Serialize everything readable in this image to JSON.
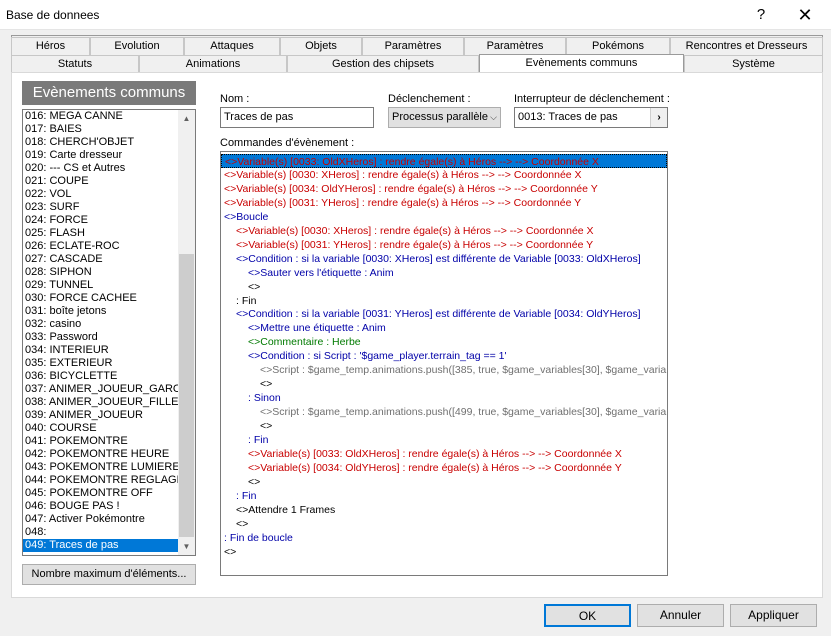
{
  "window": {
    "title": "Base de donnees",
    "help_icon": "?",
    "close_icon": "✕"
  },
  "tabs_row1": [
    "Héros",
    "Evolution",
    "Attaques",
    "Objets",
    "Paramètres",
    "Paramètres",
    "Pokémons",
    "Rencontres et Dresseurs"
  ],
  "tabs_row2": [
    "Statuts",
    "Animations",
    "Gestion des chipsets",
    "Evènements communs",
    "Système"
  ],
  "active_tab": "Evènements communs",
  "left": {
    "header": "Evènements communs",
    "items": [
      "016: MEGA CANNE",
      "017: BAIES",
      "018: CHERCH'OBJET",
      "019: Carte dresseur",
      "020: --- CS et Autres",
      "021: COUPE",
      "022: VOL",
      "023: SURF",
      "024: FORCE",
      "025: FLASH",
      "026: ECLATE-ROC",
      "027: CASCADE",
      "028: SIPHON",
      "029: TUNNEL",
      "030: FORCE CACHEE",
      "031: boîte jetons",
      "032: casino",
      "033: Password",
      "034: INTERIEUR",
      "035: EXTERIEUR",
      "036: BICYCLETTE",
      "037: ANIMER_JOUEUR_GARC",
      "038: ANIMER_JOUEUR_FILLE",
      "039: ANIMER_JOUEUR",
      "040: COURSE",
      "041: POKEMONTRE",
      "042: POKEMONTRE HEURE",
      "043: POKEMONTRE LUMIERE",
      "044: POKEMONTRE REGLAGE",
      "045: POKEMONTRE OFF",
      "046: BOUGE PAS !",
      "047: Activer Pokémontre",
      "048:",
      "049: Traces de pas"
    ],
    "selected_index": 33,
    "max_button": "Nombre maximum d'éléments..."
  },
  "form": {
    "name_label": "Nom :",
    "name_value": "Traces de pas",
    "trigger_label": "Déclenchement :",
    "trigger_value": "Processus parallèle",
    "switch_label": "Interrupteur de déclenchement :",
    "switch_value": "0013: Traces de pas",
    "commands_label": "Commandes d'évènement :"
  },
  "commands": [
    {
      "indent": 0,
      "color": "red",
      "selected": true,
      "text": "<>Variable(s) [0033: OldXHeros] : rendre égale(s) à Héros --> --> Coordonnée X"
    },
    {
      "indent": 0,
      "color": "red",
      "text": "<>Variable(s) [0030: XHeros] : rendre égale(s) à Héros --> --> Coordonnée X"
    },
    {
      "indent": 0,
      "color": "red",
      "text": "<>Variable(s) [0034: OldYHeros] : rendre égale(s) à Héros --> --> Coordonnée Y"
    },
    {
      "indent": 0,
      "color": "red",
      "text": "<>Variable(s) [0031: YHeros] : rendre égale(s) à Héros --> --> Coordonnée Y"
    },
    {
      "indent": 0,
      "color": "blue",
      "text": "<>Boucle"
    },
    {
      "indent": 1,
      "color": "red",
      "text": "<>Variable(s) [0030: XHeros] : rendre égale(s) à Héros --> --> Coordonnée X"
    },
    {
      "indent": 1,
      "color": "red",
      "text": "<>Variable(s) [0031: YHeros] : rendre égale(s) à Héros --> --> Coordonnée Y"
    },
    {
      "indent": 1,
      "color": "blue",
      "text": "<>Condition : si la variable [0030: XHeros] est différente de Variable [0033: OldXHeros]"
    },
    {
      "indent": 2,
      "color": "blue",
      "text": "<>Sauter vers l'étiquette : Anim"
    },
    {
      "indent": 2,
      "color": "black",
      "text": "<>"
    },
    {
      "indent": 1,
      "color": "black",
      "text": " :  Fin"
    },
    {
      "indent": 1,
      "color": "blue",
      "text": "<>Condition : si la variable [0031: YHeros] est différente de Variable [0034: OldYHeros]"
    },
    {
      "indent": 2,
      "color": "blue",
      "text": "<>Mettre une étiquette : Anim"
    },
    {
      "indent": 2,
      "color": "green",
      "text": "<>Commentaire : Herbe"
    },
    {
      "indent": 2,
      "color": "blue",
      "text": "<>Condition : si Script : '$game_player.terrain_tag == 1'"
    },
    {
      "indent": 3,
      "color": "gray",
      "text": "<>Script : $game_temp.animations.push([385, true, $game_variables[30], $game_varia"
    },
    {
      "indent": 3,
      "color": "black",
      "text": "<>"
    },
    {
      "indent": 2,
      "color": "blue",
      "text": " :  Sinon"
    },
    {
      "indent": 3,
      "color": "gray",
      "text": "<>Script : $game_temp.animations.push([499, true, $game_variables[30], $game_varia"
    },
    {
      "indent": 3,
      "color": "black",
      "text": "<>"
    },
    {
      "indent": 2,
      "color": "blue",
      "text": " :  Fin"
    },
    {
      "indent": 2,
      "color": "red",
      "text": "<>Variable(s) [0033: OldXHeros] : rendre égale(s) à Héros --> --> Coordonnée X"
    },
    {
      "indent": 2,
      "color": "red",
      "text": "<>Variable(s) [0034: OldYHeros] : rendre égale(s) à Héros --> --> Coordonnée Y"
    },
    {
      "indent": 2,
      "color": "black",
      "text": "<>"
    },
    {
      "indent": 1,
      "color": "blue",
      "text": " :  Fin"
    },
    {
      "indent": 1,
      "color": "black",
      "text": "<>Attendre 1 Frames"
    },
    {
      "indent": 1,
      "color": "black",
      "text": "<>"
    },
    {
      "indent": 0,
      "color": "blue",
      "text": " :  Fin de boucle"
    },
    {
      "indent": 0,
      "color": "black",
      "text": "<>"
    }
  ],
  "buttons": {
    "ok": "OK",
    "cancel": "Annuler",
    "apply": "Appliquer"
  },
  "colors": {
    "selection": "#0078d7",
    "header_gray": "#7a7a7a",
    "cmd_red": "#c80000",
    "cmd_blue": "#0000a8",
    "cmd_green": "#007a00",
    "cmd_gray": "#707070"
  },
  "icons": {
    "scroll_up": "▲",
    "scroll_down": "▼",
    "combo_arrow": "⌵",
    "picker_arrow": "›"
  }
}
